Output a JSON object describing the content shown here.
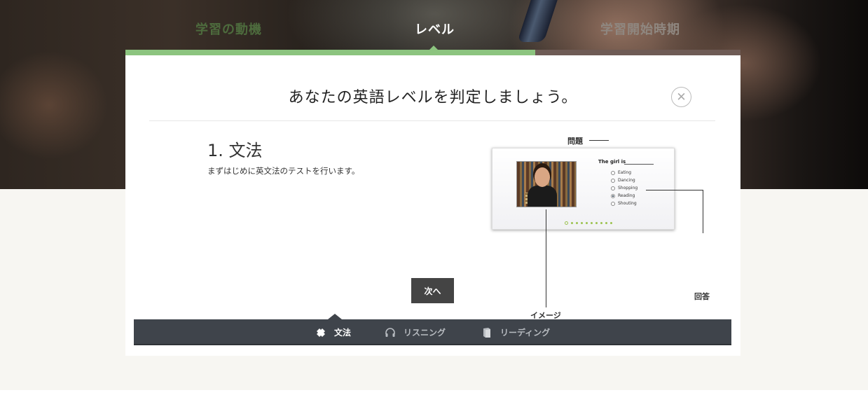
{
  "steps": {
    "items": [
      "学習の動機",
      "レベル",
      "学習開始時期"
    ]
  },
  "modal": {
    "title": "あなたの英語レベルを判定しましょう。",
    "close_icon": "close-icon",
    "section_title": "1. 文法",
    "section_desc": "まずはじめに英文法のテストを行います。",
    "next_label": "次へ"
  },
  "illustration": {
    "label_question": "問題",
    "label_image": "イメージ",
    "label_answer": "回答",
    "question_text": "The girl is",
    "options": [
      "Eating",
      "Dancing",
      "Shopping",
      "Reading",
      "Shouting"
    ],
    "selected_option": "Reading",
    "progress_dots": 10
  },
  "tabs": [
    {
      "label": "文法",
      "icon": "puzzle-icon",
      "active": true
    },
    {
      "label": "リスニング",
      "icon": "headphones-icon",
      "active": false
    },
    {
      "label": "リーディング",
      "icon": "book-icon",
      "active": false
    }
  ],
  "colors": {
    "progress_fill": "#8cc47f",
    "progress_track": "#6e5b55",
    "tabbar": "#3f444b",
    "button": "#444444"
  }
}
